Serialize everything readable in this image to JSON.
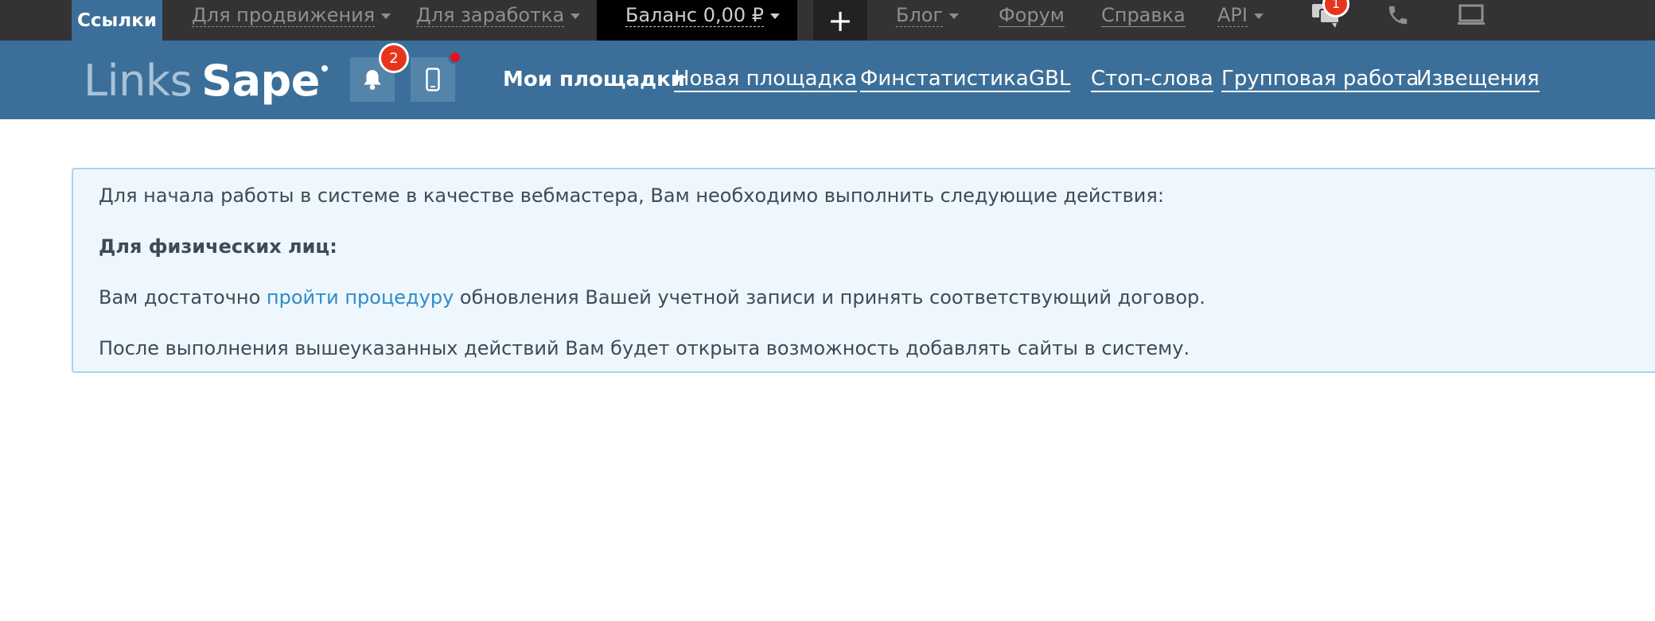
{
  "topbar": {
    "active_tab": "Ссылки",
    "promo": "Для продвижения",
    "earn": "Для заработка",
    "balance": "Баланс 0,00 ₽",
    "plus": "+",
    "blog": "Блог",
    "forum": "Форум",
    "help": "Справка",
    "api": "API",
    "messages_badge": "1"
  },
  "header": {
    "logo_links": "Links",
    "logo_sape": "Sape",
    "notifications_badge": "2",
    "nav": [
      "Мои площадки",
      "Новая площадка",
      "Финстатистика",
      "GBL",
      "Стоп-слова",
      "Групповая работа",
      "Извещения"
    ]
  },
  "info": {
    "intro": "Для начала работы в системе в качестве вебмастера, Вам необходимо выполнить следующие действия:",
    "individuals_heading": "Для физических лиц:",
    "step_before": "Вам достаточно ",
    "step_link": "пройти процедуру",
    "step_after": " обновления Вашей учетной записи и принять соответствующий договор.",
    "result": "После выполнения вышеуказанных действий Вам будет открыта возможность добавлять сайты в систему."
  }
}
